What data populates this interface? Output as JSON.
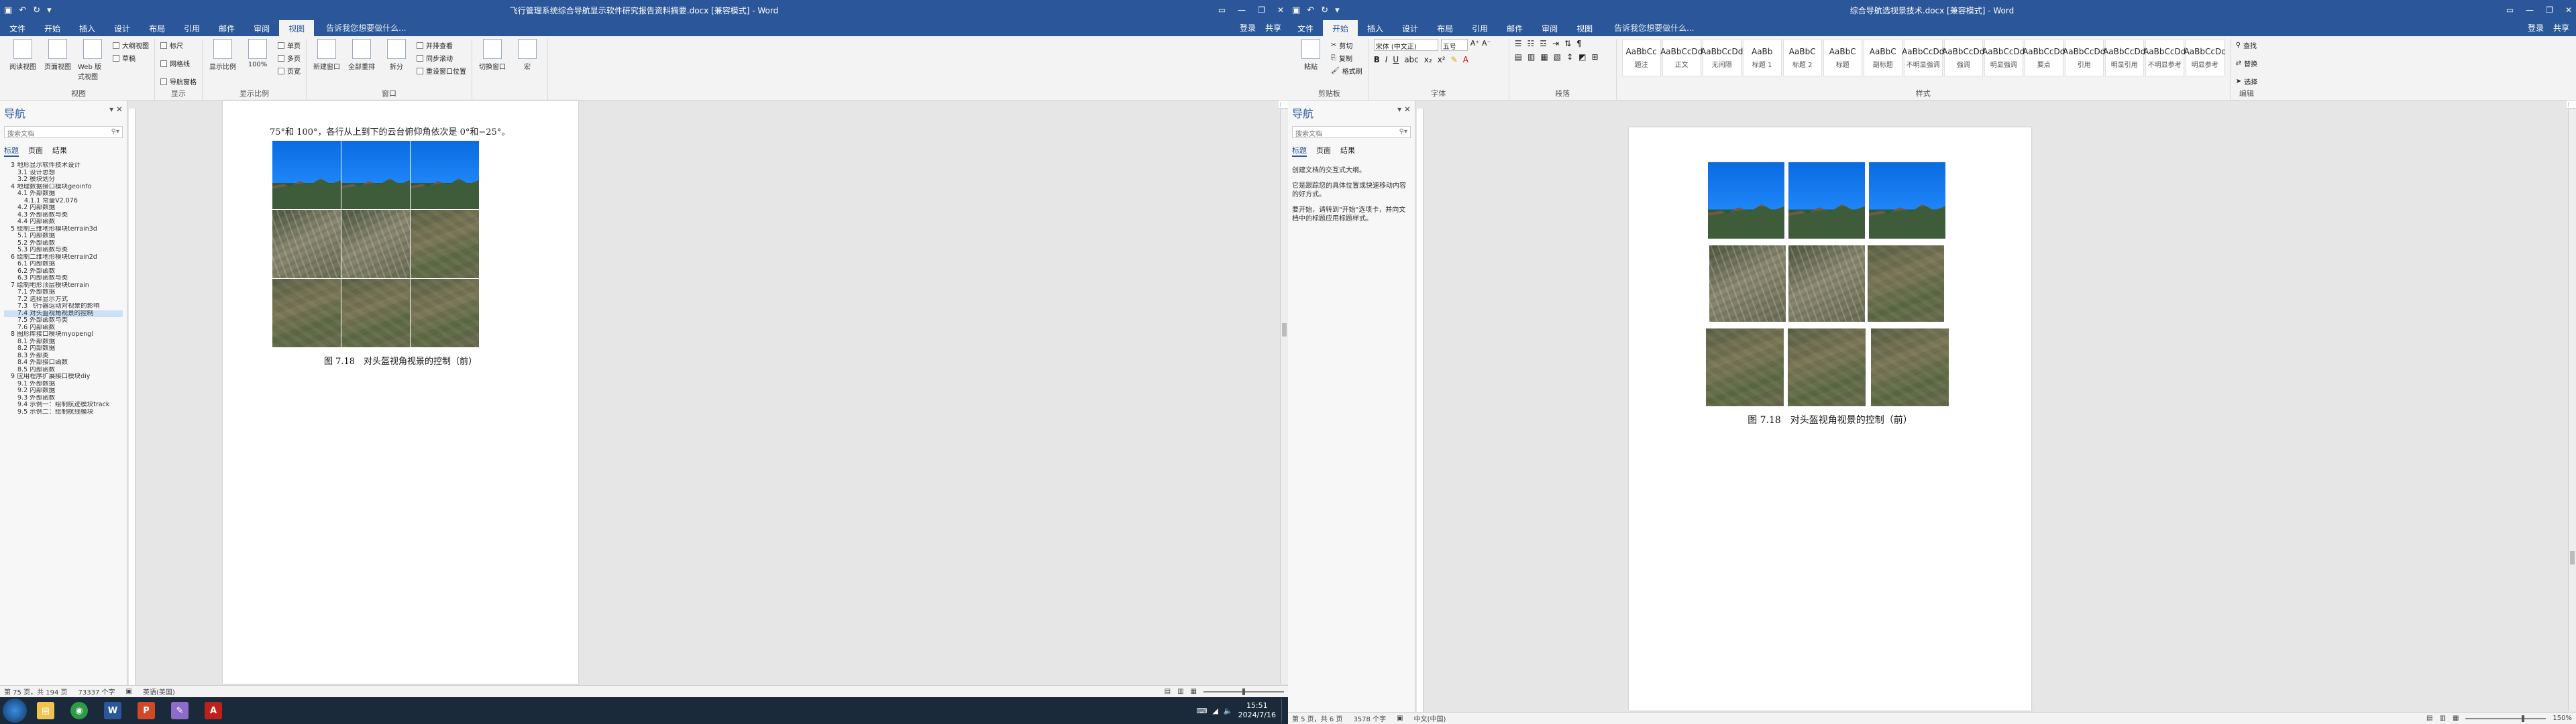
{
  "left_window": {
    "doc_title": "飞行管理系统综合导航显示软件研究报告资料摘要.docx [兼容模式] - Word",
    "qat": [
      "↶",
      "↷",
      "↻",
      "▾"
    ],
    "login": "登录",
    "share": "共享",
    "tabs": [
      "文件",
      "开始",
      "插入",
      "设计",
      "布局",
      "引用",
      "邮件",
      "审阅",
      "视图",
      "告诉我您想要做什么..."
    ],
    "active_tab": "视图",
    "ribbon_groups": [
      {
        "name": "视图",
        "buttons": [
          "阅读视图",
          "页面视图",
          "Web 版式视图"
        ],
        "checks": [
          "大纲视图",
          "草稿"
        ]
      },
      {
        "name": "显示",
        "checks": [
          "标尺",
          "网格线",
          "导航窗格"
        ]
      },
      {
        "name": "显示比例",
        "buttons": [
          "显示比例",
          "100%"
        ],
        "checks": [
          "单页",
          "多页",
          "页宽"
        ]
      },
      {
        "name": "窗口",
        "buttons": [
          "新建窗口",
          "全部重排",
          "拆分"
        ],
        "checks": [
          "并排查看",
          "同步滚动",
          "重设窗口位置"
        ]
      },
      {
        "name": "",
        "buttons": [
          "切换窗口",
          "宏"
        ]
      }
    ],
    "nav": {
      "title": "导航",
      "search_placeholder": "搜索文档",
      "tabs": [
        "标题",
        "页面",
        "结果"
      ],
      "items": [
        "3 地形显示软件技术设计",
        "3.1 设计思想",
        "3.2 模块划分",
        "4 地理数据接口模块geoinfo",
        "4.1 外部数据",
        "4.1.1 常量V2.076",
        "4.2 内部数据",
        "4.3 外部函数与类",
        "4.4 内部函数",
        "5 绘制三维地形模块terrain3d",
        "5.1 内部数据",
        "5.2 外部函数",
        "5.3 内部函数与类",
        "6 绘制二维地形模块terrain2d",
        "6.1 内部数据",
        "6.2 外部函数",
        "6.3 内部函数与类",
        "7 绘制地形顶层模块terrain",
        "7.1 外部数据",
        "7.2 选择显示方式",
        "7.3 飞行器运动对视景的影响",
        "7.4 对头盔视角视景的控制",
        "7.5 外部函数与类",
        "7.6 内部函数",
        "8 图形库接口模块myopengl",
        "8.1 外部数据",
        "8.2 内部数据",
        "8.3 外部类",
        "8.4 外部接口函数",
        "8.5 内部函数",
        "9 应用程序扩展接口模块diy",
        "9.1 外部数据",
        "9.2 内部数据",
        "9.3 外部函数",
        "9.4 示例一：绘制航迹模块track",
        "9.5 示例二：绘制航线模块"
      ],
      "selected_index": 21
    },
    "top_text": "75°和 100°，各行从上到下的云台俯仰角依次是 0°和−25°。",
    "caption": "图 7.18　对头盔视角视景的控制（前）",
    "status": {
      "page": "第 75 页，共 194 页",
      "words": "73337 个字",
      "lang": "英语(美国)"
    }
  },
  "right_window": {
    "doc_title": "综合导航选视景技术.docx [兼容模式] - Word",
    "login": "登录",
    "share": "共享",
    "tabs": [
      "文件",
      "开始",
      "插入",
      "设计",
      "布局",
      "引用",
      "邮件",
      "审阅",
      "视图",
      "告诉我您想要做什么..."
    ],
    "active_tab": "开始",
    "clipboard": {
      "name": "剪贴板",
      "paste": "粘贴",
      "cut": "剪切",
      "copy": "复制",
      "painter": "格式刷"
    },
    "font": {
      "name": "字体",
      "family": "宋体 (中文正)",
      "size": "五号"
    },
    "para_name": "段落",
    "styles_name": "样式",
    "styles": [
      {
        "preview": "AaBbCc",
        "name": "题注"
      },
      {
        "preview": "AaBbCcDd",
        "name": "正文"
      },
      {
        "preview": "AaBbCcDd",
        "name": "无间隔"
      },
      {
        "preview": "AaBb",
        "name": "标题 1"
      },
      {
        "preview": "AaBbC",
        "name": "标题 2"
      },
      {
        "preview": "AaBbC",
        "name": "标题"
      },
      {
        "preview": "AaBbC",
        "name": "副标题"
      },
      {
        "preview": "AaBbCcDd",
        "name": "不明显强调"
      },
      {
        "preview": "AaBbCcDd",
        "name": "强调"
      },
      {
        "preview": "AaBbCcDd",
        "name": "明显强调"
      },
      {
        "preview": "AaBbCcDd",
        "name": "要点"
      },
      {
        "preview": "AaBbCcDd",
        "name": "引用"
      },
      {
        "preview": "AaBbCcDd",
        "name": "明显引用"
      },
      {
        "preview": "AaBbCcDd",
        "name": "不明显参考"
      },
      {
        "preview": "AaBbCcDc",
        "name": "明显参考"
      }
    ],
    "editing": {
      "name": "编辑",
      "find": "查找",
      "replace": "替换",
      "select": "选择"
    },
    "nav": {
      "title": "导航",
      "search_placeholder": "搜索文档",
      "tabs": [
        "标题",
        "页面",
        "结果"
      ],
      "messages": [
        "创建文档的交互式大纲。",
        "它是跟踪您的具体位置或快速移动内容的好方式。",
        "要开始，请转到\"开始\"选项卡，并向文档中的标题应用标题样式。"
      ]
    },
    "caption": "图 7.18　对头盔视角视景的控制（前）",
    "status": {
      "page": "第 5 页，共 6 页",
      "words": "3578 个字",
      "lang": "中文(中国)",
      "zoom": "150%"
    }
  },
  "taskbar": {
    "apps": [
      {
        "name": "file-explorer",
        "color": "#f2c14e",
        "glyph": "▤"
      },
      {
        "name": "chrome",
        "color": "#2e9b45",
        "glyph": "◉"
      },
      {
        "name": "word",
        "color": "#2b579a",
        "glyph": "W"
      },
      {
        "name": "powerpoint",
        "color": "#d24726",
        "glyph": "P"
      },
      {
        "name": "paint",
        "color": "#8e6bc8",
        "glyph": "✎"
      },
      {
        "name": "pdf",
        "color": "#c0201a",
        "glyph": "A"
      }
    ],
    "time": "15:51",
    "date": "2024/7/16"
  }
}
